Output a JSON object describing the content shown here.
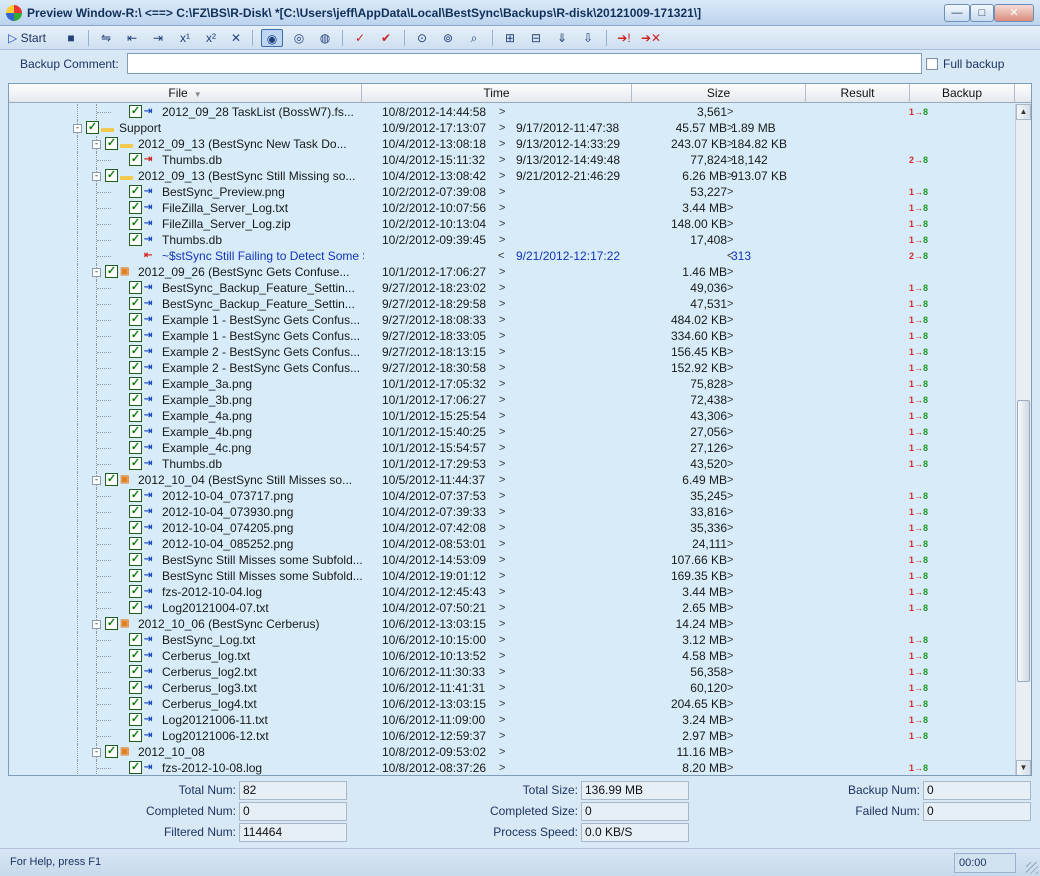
{
  "window": {
    "title": "Preview Window-R:\\ <==> C:\\FZ\\BS\\R-Disk\\ *[C:\\Users\\jeff\\AppData\\Local\\BestSync\\Backups\\R-disk\\20121009-171321\\]",
    "minimize": "—",
    "maximize": "□",
    "close": "✕"
  },
  "toolbar": {
    "start_label": "Start",
    "icons": [
      "play-icon",
      "stop-icon",
      "sync-both-icon",
      "sync-left-icon",
      "sync-right-icon",
      "x1-icon",
      "x2-icon",
      "cancel-icon",
      "preview-icon",
      "preview-filter-icon",
      "preview-all-icon",
      "check-red-icon",
      "check-mark-icon",
      "q1-icon",
      "q2-icon",
      "search-file-icon",
      "tree-icon",
      "expand-all-icon",
      "collapse-down-icon",
      "collapse-up-icon",
      "error-next-icon",
      "error-clear-icon"
    ]
  },
  "comment": {
    "label": "Backup Comment:",
    "value": "",
    "full_backup_label": "Full backup"
  },
  "columns": {
    "file": "File",
    "time": "Time",
    "size": "Size",
    "result": "Result",
    "backup": "Backup"
  },
  "rows": [
    {
      "depth": 3,
      "type": "file",
      "name": "2012_09_28 TaskList (BossW7).fs...",
      "time": "10/8/2012-14:44:58",
      "time_arrow": ">",
      "time2": "",
      "size": "3,561",
      "size_arrow": ">",
      "bar": 0,
      "size2": "",
      "backup": "1→8"
    },
    {
      "depth": 1,
      "type": "folder",
      "expander": "-",
      "name": "Support",
      "time": "10/9/2012-17:13:07",
      "time_arrow": ">",
      "time2": "9/17/2012-11:47:38",
      "size": "45.57 MB",
      "size_arrow": ">",
      "bar": 0.35,
      "size2": "1.89 MB",
      "backup": ""
    },
    {
      "depth": 2,
      "type": "folder",
      "expander": "-",
      "name": "2012_09_13 (BestSync New Task Do...",
      "time": "10/4/2012-13:08:18",
      "time_arrow": ">",
      "time2": "9/13/2012-14:33:29",
      "size": "243.07 KB",
      "size_arrow": ">",
      "bar": 0,
      "size2": "184.82 KB",
      "backup": ""
    },
    {
      "depth": 3,
      "type": "x",
      "name": "Thumbs.db",
      "time": "10/4/2012-15:11:32",
      "time_arrow": ">",
      "time2": "9/13/2012-14:49:48",
      "size": "77,824",
      "size_arrow": ">",
      "bar": 0.42,
      "size2": "18,142",
      "backup": "2→8"
    },
    {
      "depth": 2,
      "type": "folder",
      "expander": "-",
      "name": "2012_09_13 (BestSync Still Missing so...",
      "time": "10/4/2012-13:08:42",
      "time_arrow": ">",
      "time2": "9/21/2012-21:46:29",
      "size": "6.26 MB",
      "size_arrow": ">",
      "bar": 0.18,
      "size2": "913.07 KB",
      "backup": ""
    },
    {
      "depth": 3,
      "type": "file",
      "name": "BestSync_Preview.png",
      "time": "10/2/2012-07:39:08",
      "time_arrow": ">",
      "time2": "",
      "size": "53,227",
      "size_arrow": ">",
      "bar": 0,
      "size2": "",
      "backup": "1→8"
    },
    {
      "depth": 3,
      "type": "file",
      "name": "FileZilla_Server_Log.txt",
      "time": "10/2/2012-10:07:56",
      "time_arrow": ">",
      "time2": "",
      "size": "3.44 MB",
      "size_arrow": ">",
      "bar": 0.85,
      "size2": "",
      "backup": "1→8"
    },
    {
      "depth": 3,
      "type": "file",
      "name": "FileZilla_Server_Log.zip",
      "time": "10/2/2012-10:13:04",
      "time_arrow": ">",
      "time2": "",
      "size": "148.00 KB",
      "size_arrow": ">",
      "bar": 0,
      "size2": "",
      "backup": "1→8"
    },
    {
      "depth": 3,
      "type": "file",
      "name": "Thumbs.db",
      "time": "10/2/2012-09:39:45",
      "time_arrow": ">",
      "time2": "",
      "size": "17,408",
      "size_arrow": ">",
      "bar": 0,
      "size2": "",
      "backup": "1→8"
    },
    {
      "depth": 3,
      "type": "blue",
      "name": "~$stSync Still Failing to Detect Some Subfolders and File...",
      "time": "",
      "time_arrow": "<",
      "time2": "9/21/2012-12:17:22",
      "size": "",
      "size_arrow": "<",
      "bar": 0,
      "size2": "313",
      "backup": "2→8"
    },
    {
      "depth": 2,
      "type": "folder2",
      "expander": "-",
      "name": "2012_09_26 (BestSync Gets Confuse...",
      "time": "10/1/2012-17:06:27",
      "time_arrow": ">",
      "time2": "",
      "size": "1.46 MB",
      "size_arrow": ">",
      "bar": 0,
      "size2": "",
      "backup": ""
    },
    {
      "depth": 3,
      "type": "file",
      "name": "BestSync_Backup_Feature_Settin...",
      "time": "9/27/2012-18:23:02",
      "time_arrow": ">",
      "time2": "",
      "size": "49,036",
      "size_arrow": ">",
      "bar": 0,
      "size2": "",
      "backup": "1→8"
    },
    {
      "depth": 3,
      "type": "file",
      "name": "BestSync_Backup_Feature_Settin...",
      "time": "9/27/2012-18:29:58",
      "time_arrow": ">",
      "time2": "",
      "size": "47,531",
      "size_arrow": ">",
      "bar": 0,
      "size2": "",
      "backup": "1→8"
    },
    {
      "depth": 3,
      "type": "file",
      "name": "Example 1 - BestSync Gets Confus...",
      "time": "9/27/2012-18:08:33",
      "time_arrow": ">",
      "time2": "",
      "size": "484.02 KB",
      "size_arrow": ">",
      "bar": 0.85,
      "size2": "",
      "backup": "1→8"
    },
    {
      "depth": 3,
      "type": "file",
      "name": "Example 1 - BestSync Gets Confus...",
      "time": "9/27/2012-18:33:05",
      "time_arrow": ">",
      "time2": "",
      "size": "334.60 KB",
      "size_arrow": ">",
      "bar": 0.6,
      "size2": "",
      "backup": "1→8"
    },
    {
      "depth": 3,
      "type": "file",
      "name": "Example 2 - BestSync Gets Confus...",
      "time": "9/27/2012-18:13:15",
      "time_arrow": ">",
      "time2": "",
      "size": "156.45 KB",
      "size_arrow": ">",
      "bar": 0.25,
      "size2": "",
      "backup": "1→8"
    },
    {
      "depth": 3,
      "type": "file",
      "name": "Example 2 - BestSync Gets Confus...",
      "time": "9/27/2012-18:30:58",
      "time_arrow": ">",
      "time2": "",
      "size": "152.92 KB",
      "size_arrow": ">",
      "bar": 0.25,
      "size2": "",
      "backup": "1→8"
    },
    {
      "depth": 3,
      "type": "file",
      "name": "Example_3a.png",
      "time": "10/1/2012-17:05:32",
      "time_arrow": ">",
      "time2": "",
      "size": "75,828",
      "size_arrow": ">",
      "bar": 0.12,
      "size2": "",
      "backup": "1→8"
    },
    {
      "depth": 3,
      "type": "file",
      "name": "Example_3b.png",
      "time": "10/1/2012-17:06:27",
      "time_arrow": ">",
      "time2": "",
      "size": "72,438",
      "size_arrow": ">",
      "bar": 0.12,
      "size2": "",
      "backup": "1→8"
    },
    {
      "depth": 3,
      "type": "file",
      "name": "Example_4a.png",
      "time": "10/1/2012-15:25:54",
      "time_arrow": ">",
      "time2": "",
      "size": "43,306",
      "size_arrow": ">",
      "bar": 0,
      "size2": "",
      "backup": "1→8"
    },
    {
      "depth": 3,
      "type": "file",
      "name": "Example_4b.png",
      "time": "10/1/2012-15:40:25",
      "time_arrow": ">",
      "time2": "",
      "size": "27,056",
      "size_arrow": ">",
      "bar": 0,
      "size2": "",
      "backup": "1→8"
    },
    {
      "depth": 3,
      "type": "file",
      "name": "Example_4c.png",
      "time": "10/1/2012-15:54:57",
      "time_arrow": ">",
      "time2": "",
      "size": "27,126",
      "size_arrow": ">",
      "bar": 0,
      "size2": "",
      "backup": "1→8"
    },
    {
      "depth": 3,
      "type": "file",
      "name": "Thumbs.db",
      "time": "10/1/2012-17:29:53",
      "time_arrow": ">",
      "time2": "",
      "size": "43,520",
      "size_arrow": ">",
      "bar": 0.08,
      "size2": "",
      "backup": "1→8"
    },
    {
      "depth": 2,
      "type": "folder2",
      "expander": "-",
      "name": "2012_10_04 (BestSync Still Misses so...",
      "time": "10/5/2012-11:44:37",
      "time_arrow": ">",
      "time2": "",
      "size": "6.49 MB",
      "size_arrow": ">",
      "bar": 0.1,
      "size2": "",
      "backup": ""
    },
    {
      "depth": 3,
      "type": "file",
      "name": "2012-10-04_073717.png",
      "time": "10/4/2012-07:37:53",
      "time_arrow": ">",
      "time2": "",
      "size": "35,245",
      "size_arrow": ">",
      "bar": 0,
      "size2": "",
      "backup": "1→8"
    },
    {
      "depth": 3,
      "type": "file",
      "name": "2012-10-04_073930.png",
      "time": "10/4/2012-07:39:33",
      "time_arrow": ">",
      "time2": "",
      "size": "33,816",
      "size_arrow": ">",
      "bar": 0,
      "size2": "",
      "backup": "1→8"
    },
    {
      "depth": 3,
      "type": "file",
      "name": "2012-10-04_074205.png",
      "time": "10/4/2012-07:42:08",
      "time_arrow": ">",
      "time2": "",
      "size": "35,336",
      "size_arrow": ">",
      "bar": 0,
      "size2": "",
      "backup": "1→8"
    },
    {
      "depth": 3,
      "type": "file",
      "name": "2012-10-04_085252.png",
      "time": "10/4/2012-08:53:01",
      "time_arrow": ">",
      "time2": "",
      "size": "24,111",
      "size_arrow": ">",
      "bar": 0,
      "size2": "",
      "backup": "1→8"
    },
    {
      "depth": 3,
      "type": "file",
      "name": "BestSync Still Misses some Subfold...",
      "time": "10/4/2012-14:53:09",
      "time_arrow": ">",
      "time2": "",
      "size": "107.66 KB",
      "size_arrow": ">",
      "bar": 0,
      "size2": "",
      "backup": "1→8"
    },
    {
      "depth": 3,
      "type": "file",
      "name": "BestSync Still Misses some Subfold...",
      "time": "10/4/2012-19:01:12",
      "time_arrow": ">",
      "time2": "",
      "size": "169.35 KB",
      "size_arrow": ">",
      "bar": 0,
      "size2": "",
      "backup": "1→8"
    },
    {
      "depth": 3,
      "type": "file",
      "name": "fzs-2012-10-04.log",
      "time": "10/4/2012-12:45:43",
      "time_arrow": ">",
      "time2": "",
      "size": "3.44 MB",
      "size_arrow": ">",
      "bar": 0.65,
      "size2": "",
      "backup": "1→8"
    },
    {
      "depth": 3,
      "type": "file",
      "name": "Log20121004-07.txt",
      "time": "10/4/2012-07:50:21",
      "time_arrow": ">",
      "time2": "",
      "size": "2.65 MB",
      "size_arrow": ">",
      "bar": 0.65,
      "size2": "",
      "backup": "1→8"
    },
    {
      "depth": 2,
      "type": "folder2",
      "expander": "-",
      "name": "2012_10_06 (BestSync Cerberus)",
      "time": "10/6/2012-13:03:15",
      "time_arrow": ">",
      "time2": "",
      "size": "14.24 MB",
      "size_arrow": ">",
      "bar": 0.85,
      "size2": "",
      "backup": ""
    },
    {
      "depth": 3,
      "type": "file",
      "name": "BestSync_Log.txt",
      "time": "10/6/2012-10:15:00",
      "time_arrow": ">",
      "time2": "",
      "size": "3.12 MB",
      "size_arrow": ">",
      "bar": 0.65,
      "size2": "",
      "backup": "1→8"
    },
    {
      "depth": 3,
      "type": "file",
      "name": "Cerberus_log.txt",
      "time": "10/6/2012-10:13:52",
      "time_arrow": ">",
      "time2": "",
      "size": "4.58 MB",
      "size_arrow": ">",
      "bar": 0.85,
      "size2": "",
      "backup": "1→8"
    },
    {
      "depth": 3,
      "type": "file",
      "name": "Cerberus_log2.txt",
      "time": "10/6/2012-11:30:33",
      "time_arrow": ">",
      "time2": "",
      "size": "56,358",
      "size_arrow": ">",
      "bar": 0,
      "size2": "",
      "backup": "1→8"
    },
    {
      "depth": 3,
      "type": "file",
      "name": "Cerberus_log3.txt",
      "time": "10/6/2012-11:41:31",
      "time_arrow": ">",
      "time2": "",
      "size": "60,120",
      "size_arrow": ">",
      "bar": 0,
      "size2": "",
      "backup": "1→8"
    },
    {
      "depth": 3,
      "type": "file",
      "name": "Cerberus_log4.txt",
      "time": "10/6/2012-13:03:15",
      "time_arrow": ">",
      "time2": "",
      "size": "204.65 KB",
      "size_arrow": ">",
      "bar": 0,
      "size2": "",
      "backup": "1→8"
    },
    {
      "depth": 3,
      "type": "file",
      "name": "Log20121006-11.txt",
      "time": "10/6/2012-11:09:00",
      "time_arrow": ">",
      "time2": "",
      "size": "3.24 MB",
      "size_arrow": ">",
      "bar": 0.65,
      "size2": "",
      "backup": "1→8"
    },
    {
      "depth": 3,
      "type": "file",
      "name": "Log20121006-12.txt",
      "time": "10/6/2012-12:59:37",
      "time_arrow": ">",
      "time2": "",
      "size": "2.97 MB",
      "size_arrow": ">",
      "bar": 0.65,
      "size2": "",
      "backup": "1→8"
    },
    {
      "depth": 2,
      "type": "folder2",
      "expander": "-",
      "name": "2012_10_08",
      "time": "10/8/2012-09:53:02",
      "time_arrow": ">",
      "time2": "",
      "size": "11.16 MB",
      "size_arrow": ">",
      "bar": 0.65,
      "size2": "",
      "backup": ""
    },
    {
      "depth": 3,
      "type": "file",
      "name": "fzs-2012-10-08.log",
      "time": "10/8/2012-08:37:26",
      "time_arrow": ">",
      "time2": "",
      "size": "8.20 MB",
      "size_arrow": ">",
      "bar": 0.85,
      "size2": "",
      "backup": "1→8"
    }
  ],
  "stats": {
    "total_num_label": "Total Num:",
    "total_num": "82",
    "completed_num_label": "Completed Num:",
    "completed_num": "0",
    "filtered_num_label": "Filtered Num:",
    "filtered_num": "114464",
    "total_size_label": "Total Size:",
    "total_size": "136.99 MB",
    "completed_size_label": "Completed Size:",
    "completed_size": "0",
    "process_speed_label": "Process Speed:",
    "process_speed": "0.0 KB/S",
    "backup_num_label": "Backup Num:",
    "backup_num": "0",
    "failed_num_label": "Failed Num:",
    "failed_num": "0"
  },
  "status": {
    "help_text": "For Help, press F1",
    "elapsed": "00:00"
  },
  "colors": {
    "bar": "#79cdf6",
    "grid_bg": "#d7ecf8",
    "blue_text": "#1434b6",
    "backup_red": "#d62a2a",
    "backup_green": "#1c9b1c"
  }
}
